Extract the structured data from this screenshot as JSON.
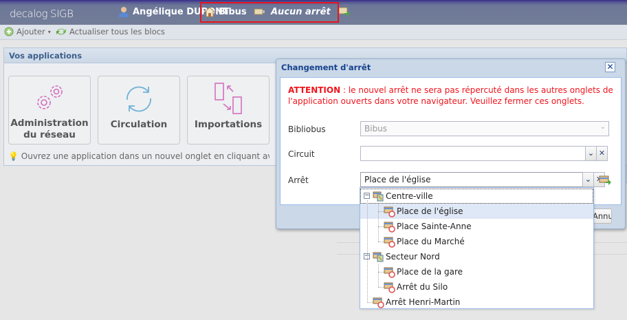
{
  "topbar": {
    "logo": "decalog",
    "logo_suffix": "SIGB",
    "user": "Angélique DUPONT",
    "bibliobus": "Bibus",
    "stop": "Aucun arrêt"
  },
  "toolbar": {
    "add": "Ajouter",
    "refresh": "Actualiser tous les blocs"
  },
  "panel": {
    "title": "Vos applications",
    "tiles": [
      {
        "label": "Administration du réseau",
        "icon": "gears-icon"
      },
      {
        "label": "Circulation",
        "icon": "sync-icon"
      },
      {
        "label": "Importations",
        "icon": "transfer-icon"
      }
    ],
    "hint": "Ouvrez une application dans un nouvel onglet en cliquant avec la molette"
  },
  "dialog": {
    "title": "Changement d'arrêt",
    "warning_strong": "ATTENTION",
    "warning_text": " : le nouvel arrêt ne sera pas répercuté dans les autres onglets de l'application ouverts dans votre navigateur. Veuillez fermer ces onglets.",
    "fields": {
      "bibliobus_label": "Bibliobus",
      "bibliobus_value": "Bibus",
      "circuit_label": "Circuit",
      "circuit_value": "",
      "arret_label": "Arrêt",
      "arret_value": "Place de l'église"
    },
    "footer_button": "Annuler",
    "tree": [
      {
        "label": "Centre-ville",
        "type": "group",
        "level": 0
      },
      {
        "label": "Place de l'église",
        "type": "stop",
        "level": 1,
        "selected": true
      },
      {
        "label": "Place Sainte-Anne",
        "type": "stop",
        "level": 1
      },
      {
        "label": "Place du Marché",
        "type": "stop",
        "level": 1
      },
      {
        "label": "Secteur Nord",
        "type": "group",
        "level": 0
      },
      {
        "label": "Place de la gare",
        "type": "stop",
        "level": 1
      },
      {
        "label": "Arrêt du Silo",
        "type": "stop",
        "level": 1
      },
      {
        "label": "Arrêt Henri-Martin",
        "type": "stop",
        "level": 0
      }
    ]
  },
  "colors": {
    "warning": "#f0141c",
    "accent": "#15428b",
    "highlight": "#e8141c"
  }
}
